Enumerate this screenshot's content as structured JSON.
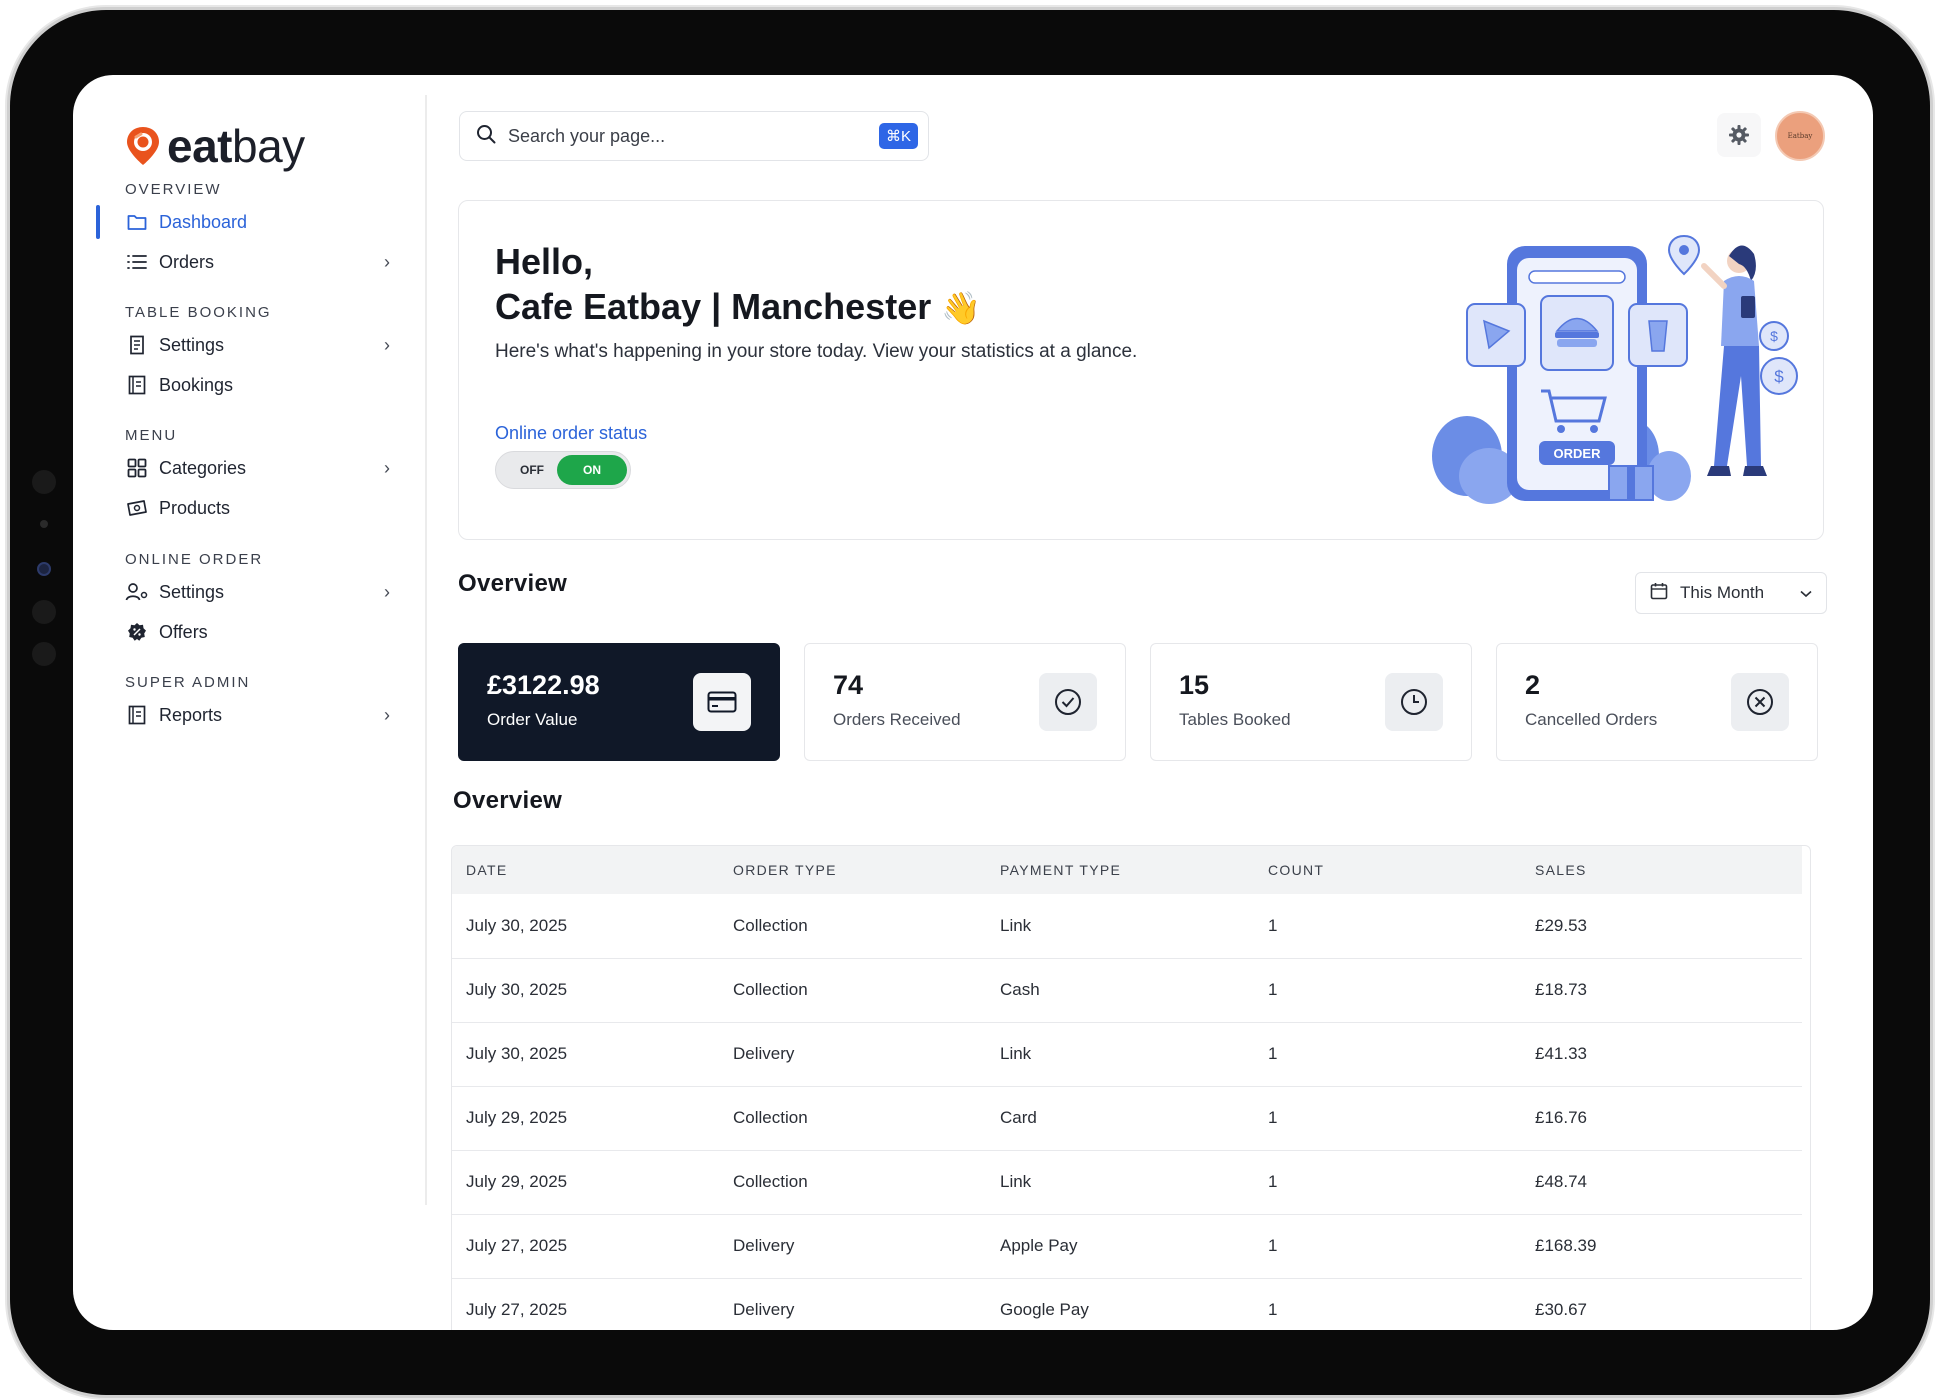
{
  "brand": {
    "name_part1": "eat",
    "name_part2": "bay",
    "accent": "#e9531d"
  },
  "sidebar": {
    "sections": [
      {
        "title": "OVERVIEW",
        "items": [
          {
            "label": "Dashboard",
            "icon": "folder-icon",
            "active": true,
            "has_submenu": false
          },
          {
            "label": "Orders",
            "icon": "list-icon",
            "active": false,
            "has_submenu": true
          }
        ]
      },
      {
        "title": "TABLE BOOKING",
        "items": [
          {
            "label": "Settings",
            "icon": "document-icon",
            "has_submenu": true
          },
          {
            "label": "Bookings",
            "icon": "book-icon",
            "has_submenu": false
          }
        ]
      },
      {
        "title": "MENU",
        "items": [
          {
            "label": "Categories",
            "icon": "grid-icon",
            "has_submenu": true
          },
          {
            "label": "Products",
            "icon": "ticket-icon",
            "has_submenu": false
          }
        ]
      },
      {
        "title": "ONLINE ORDER",
        "items": [
          {
            "label": "Settings",
            "icon": "user-gear-icon",
            "has_submenu": true
          },
          {
            "label": "Offers",
            "icon": "percent-badge-icon",
            "has_submenu": false
          }
        ]
      },
      {
        "title": "SUPER ADMIN",
        "items": [
          {
            "label": "Reports",
            "icon": "report-icon",
            "has_submenu": true
          }
        ]
      }
    ],
    "active_color": "#2b63d9"
  },
  "search": {
    "placeholder": "Search your page...",
    "shortcut": "⌘K"
  },
  "header": {
    "settings_icon": "gear-icon",
    "avatar_text": "Eatbay"
  },
  "hero": {
    "greeting": "Hello,",
    "store_name": "Cafe Eatbay | Manchester",
    "wave": "👋",
    "subtitle": "Here's what's happening in your store today. View your statistics at a glance.",
    "order_status_label": "Online order status",
    "toggle_off": "OFF",
    "toggle_on": "ON",
    "toggle_state": "on",
    "illustration_label": "ORDER"
  },
  "overview": {
    "title": "Overview",
    "period": "This Month",
    "stats": [
      {
        "value": "£3122.98",
        "label": "Order Value",
        "icon": "card-icon",
        "highlight": true
      },
      {
        "value": "74",
        "label": "Orders Received",
        "icon": "check-circle-icon",
        "highlight": false
      },
      {
        "value": "15",
        "label": "Tables Booked",
        "icon": "clock-icon",
        "highlight": false
      },
      {
        "value": "2",
        "label": "Cancelled Orders",
        "icon": "x-circle-icon",
        "highlight": false
      }
    ]
  },
  "table": {
    "title": "Overview",
    "columns": [
      "DATE",
      "ORDER TYPE",
      "PAYMENT TYPE",
      "COUNT",
      "SALES"
    ],
    "rows": [
      [
        "July 30, 2025",
        "Collection",
        "Link",
        "1",
        "£29.53"
      ],
      [
        "July 30, 2025",
        "Collection",
        "Cash",
        "1",
        "£18.73"
      ],
      [
        "July 30, 2025",
        "Delivery",
        "Link",
        "1",
        "£41.33"
      ],
      [
        "July 29, 2025",
        "Collection",
        "Card",
        "1",
        "£16.76"
      ],
      [
        "July 29, 2025",
        "Collection",
        "Link",
        "1",
        "£48.74"
      ],
      [
        "July 27, 2025",
        "Delivery",
        "Apple Pay",
        "1",
        "£168.39"
      ],
      [
        "July 27, 2025",
        "Delivery",
        "Google Pay",
        "1",
        "£30.67"
      ]
    ]
  }
}
